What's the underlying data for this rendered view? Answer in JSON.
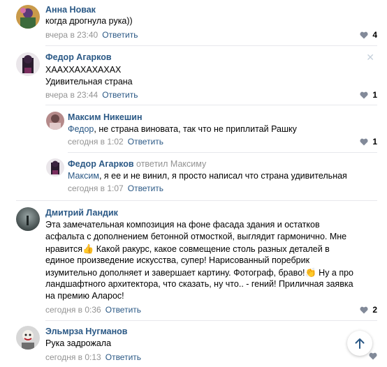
{
  "comments": [
    {
      "author": "Анна Новак",
      "lines": [
        "когда дрогнула рука))"
      ],
      "time": "вчера в 23:40",
      "reply_label": "Ответить",
      "likes": "4"
    },
    {
      "author": "Федор Агарков",
      "lines": [
        "ХААХХАХАХАХАХ",
        "Удивительная страна"
      ],
      "time": "вчера в 23:44",
      "reply_label": "Ответить",
      "likes": "1",
      "close": "✕"
    },
    {
      "author": "Максим Никешин",
      "mention": "Федор",
      "text_after_mention": ", не страна виновата, так что не приплитай Рашку",
      "time": "сегодня в 1:02",
      "reply_label": "Ответить",
      "likes": "1"
    },
    {
      "author": "Федор Агарков",
      "replied_to": "ответил Максиму",
      "mention": "Максим",
      "text_after_mention": ", я ее и не винил, я просто написал что страна удивительная",
      "time": "сегодня в 1:07",
      "reply_label": "Ответить"
    },
    {
      "author": "Дмитрий Ландик",
      "lines": [
        "Эта замечательная композиция на фоне фасада здания и остатков",
        "асфальта с дополнением бетонной отмосткой, выглядит гармонично. Мне",
        "нравится",
        " Какой ракурс, какое совмещение столь разных деталей в",
        "единое произведение искусства, супер! Нарисованный поребрик",
        "изумительно дополняет и завершает картину. Фотограф, браво!",
        " Ну а про",
        "ландшафтного архитектора, что сказать, ну что.. - гений! Приличная заявка",
        "на премию Аларос!"
      ],
      "time": "сегодня в 0:36",
      "reply_label": "Ответить",
      "likes": "2"
    },
    {
      "author": "Эльмрза Нугманов",
      "lines": [
        "Рука задрожала"
      ],
      "time": "сегодня в 0:13",
      "reply_label": "Ответить"
    }
  ],
  "icons": {
    "like": "heart-icon",
    "thumbs": "thumbs-up-emoji",
    "clap": "clap-emoji",
    "scroll_up": "arrow-up-icon"
  },
  "colors": {
    "link": "#2a5885",
    "meta": "#939393",
    "separator": "#e7e8ec"
  }
}
